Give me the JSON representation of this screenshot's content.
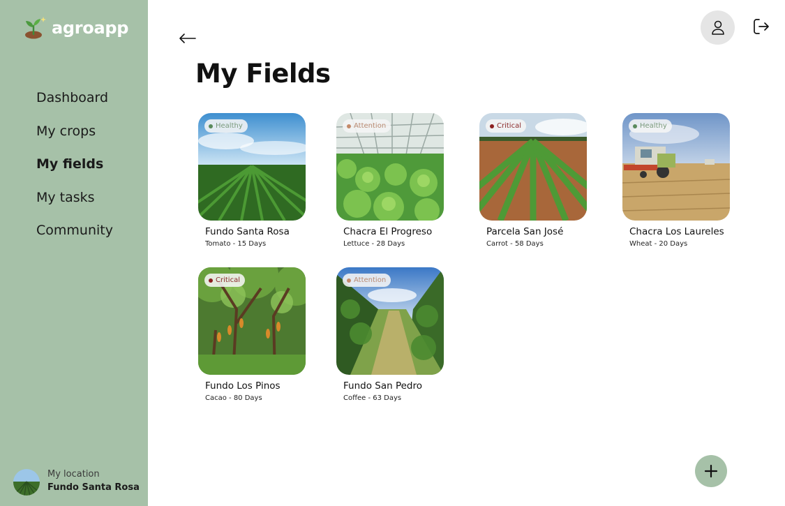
{
  "app": {
    "name": "agroapp"
  },
  "sidebar": {
    "items": [
      {
        "label": "Dashboard",
        "active": false
      },
      {
        "label": "My crops",
        "active": false
      },
      {
        "label": "My fields",
        "active": true
      },
      {
        "label": "My tasks",
        "active": false
      },
      {
        "label": "Community",
        "active": false
      }
    ],
    "location": {
      "caption": "My location",
      "value": "Fundo Santa Rosa"
    }
  },
  "header": {
    "back_icon": "arrow-left-icon",
    "profile_icon": "user-icon",
    "logout_icon": "logout-icon"
  },
  "main": {
    "title": "My Fields",
    "fields": [
      {
        "name": "Fundo Santa Rosa",
        "meta": "Tomato - 15 Days",
        "status": "Healthy",
        "status_color": "#5a8a5c",
        "status_text_color": "#7a9a7c"
      },
      {
        "name": "Chacra El Progreso",
        "meta": "Lettuce - 28 Days",
        "status": "Attention",
        "status_color": "#c48a6a",
        "status_text_color": "#b98a72"
      },
      {
        "name": "Parcela San José",
        "meta": "Carrot - 58 Days",
        "status": "Critical",
        "status_color": "#8b2020",
        "status_text_color": "#8b2b2b"
      },
      {
        "name": "Chacra Los Laureles",
        "meta": "Wheat - 20 Days",
        "status": "Healthy",
        "status_color": "#5a8a5c",
        "status_text_color": "#7a9a7c"
      },
      {
        "name": "Fundo Los Pinos",
        "meta": "Cacao - 80 Days",
        "status": "Critical",
        "status_color": "#8b2020",
        "status_text_color": "#8b2b2b"
      },
      {
        "name": "Fundo San Pedro",
        "meta": "Coffee - 63 Days",
        "status": "Attention",
        "status_color": "#c48a6a",
        "status_text_color": "#b98a72"
      }
    ]
  },
  "fab": {
    "icon": "plus-icon"
  },
  "colors": {
    "sidebar": "#a6c1a8",
    "accent": "#a6c1a8"
  }
}
